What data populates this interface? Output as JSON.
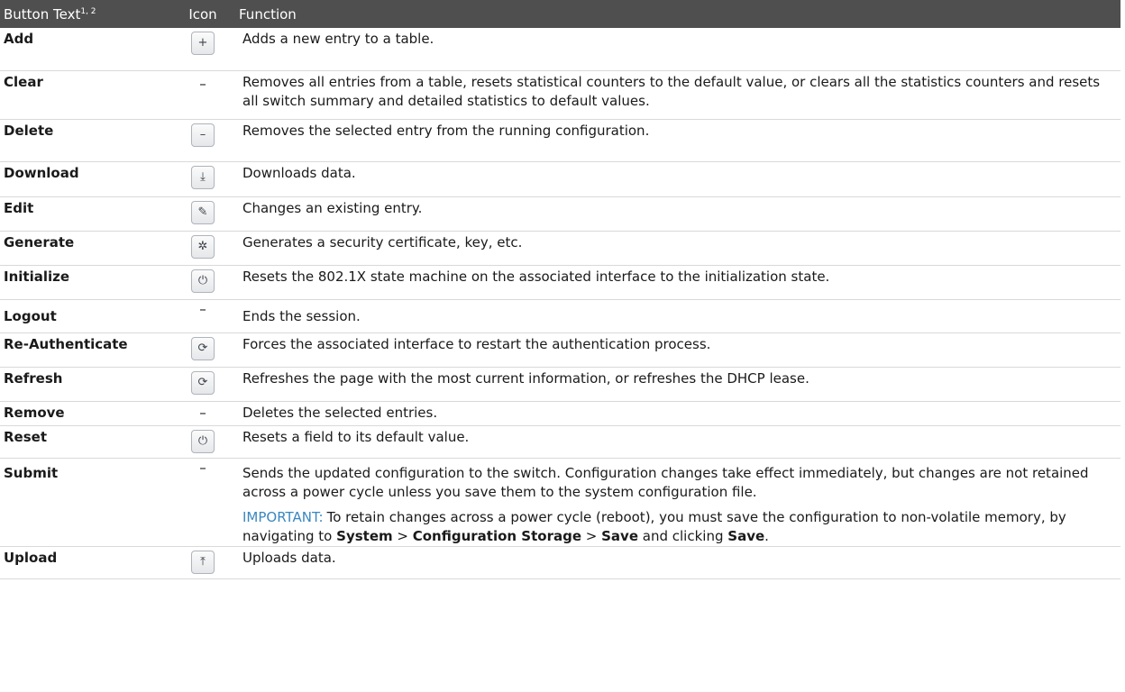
{
  "header": {
    "col_button": "Button Text",
    "col_button_sup": "1, 2",
    "col_icon": "Icon",
    "col_function": "Function"
  },
  "rows": [
    {
      "name": "Add",
      "icon": "plus-icon",
      "glyph": "+",
      "desc": "Adds a new entry to a table."
    },
    {
      "name": "Clear",
      "icon": "none",
      "glyph": "–",
      "desc": "Removes all entries from a table, resets statistical counters to the default value, or clears all the statistics counters and resets all switch summary and detailed statistics to default values."
    },
    {
      "name": "Delete",
      "icon": "minus-icon",
      "glyph": "–",
      "desc": "Removes the selected entry from the running configuration."
    },
    {
      "name": "Download",
      "icon": "download-icon",
      "glyph": "⤓",
      "desc": "Downloads data."
    },
    {
      "name": "Edit",
      "icon": "pencil-icon",
      "glyph": "✎",
      "desc": "Changes an existing entry."
    },
    {
      "name": "Generate",
      "icon": "gear-icon",
      "glyph": "✲",
      "desc": "Generates a security certificate, key, etc."
    },
    {
      "name": "Initialize",
      "icon": "power-icon",
      "glyph": "⏻",
      "desc": "Resets the 802.1X state machine on the associated interface to the initialization state."
    },
    {
      "name": "Logout",
      "icon": "none",
      "glyph": "–",
      "desc": "Ends the session."
    },
    {
      "name": "Re-Authenticate",
      "icon": "refresh-icon",
      "glyph": "⟳",
      "desc": "Forces the associated interface to restart the authentication process."
    },
    {
      "name": "Refresh",
      "icon": "refresh-icon",
      "glyph": "⟳",
      "desc": "Refreshes the page with the most current information, or refreshes the DHCP lease."
    },
    {
      "name": "Remove",
      "icon": "none",
      "glyph": "–",
      "desc": "Deletes the selected entries."
    },
    {
      "name": "Reset",
      "icon": "power-icon",
      "glyph": "⏻",
      "desc": "Resets a field to its default value."
    },
    {
      "name": "Submit",
      "icon": "none",
      "glyph": "–",
      "desc": "Sends the updated configuration to the switch. Configuration changes take effect immediately, but changes are not retained across a power cycle unless you save them to the system configuration file."
    },
    {
      "name": "Upload",
      "icon": "upload-icon",
      "glyph": "⤒",
      "desc": "Uploads data."
    }
  ],
  "submit_note": {
    "label": "IMPORTANT:",
    "text_1": "To retain changes across a power cycle (reboot), you must save the configuration to non-volatile memory, by navigating to ",
    "path_1": "System",
    "sep_1": " > ",
    "path_2": "Configuration Storage",
    "sep_2": " > ",
    "path_3": "Save",
    "text_2": " and clicking ",
    "action": "Save",
    "end": "."
  },
  "colors": {
    "header_bg": "#4f4f4f",
    "note_label": "#3a87c0",
    "row_divider": "#d9d9d9"
  }
}
